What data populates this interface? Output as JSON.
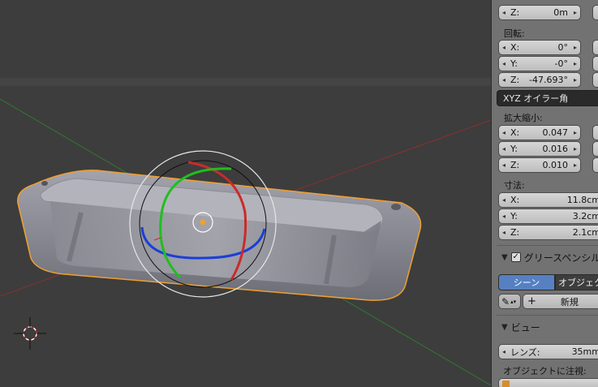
{
  "location": {
    "z": {
      "label": "Z:",
      "value": "0m"
    }
  },
  "rotation": {
    "header": "回転:",
    "x": {
      "label": "X:",
      "value": "0°"
    },
    "y": {
      "label": "Y:",
      "value": "-0°"
    },
    "z": {
      "label": "Z:",
      "value": "-47.693°"
    },
    "mode": "XYZ オイラー角"
  },
  "scale": {
    "header": "拡大縮小:",
    "x": {
      "label": "X:",
      "value": "0.047"
    },
    "y": {
      "label": "Y:",
      "value": "0.016"
    },
    "z": {
      "label": "Z:",
      "value": "0.010"
    }
  },
  "dimensions": {
    "header": "寸法:",
    "x": {
      "label": "X:",
      "value": "11.8cm"
    },
    "y": {
      "label": "Y:",
      "value": "3.2cm"
    },
    "z": {
      "label": "Z:",
      "value": "2.1cm"
    }
  },
  "grease_pencil": {
    "header": "グリースペンシル",
    "tab_scene": "シーン",
    "tab_object": "オブジェクト",
    "new_button": "新規"
  },
  "view": {
    "header": "ビュー",
    "lens": {
      "label": "レンズ:",
      "value": "35mm"
    },
    "lock_label": "オブジェクトに注視:"
  },
  "colors": {
    "axis_x": "#cc2a2a",
    "axis_y": "#1fbf1f",
    "axis_z": "#1a3fd6",
    "selection_outline": "#f0a030",
    "active_tab": "#5680c2"
  },
  "icons": {
    "arrow_left": "◂",
    "arrow_right": "▸",
    "triangle_down": "▼",
    "check": "✓",
    "pencil": "✎",
    "plus": "+"
  }
}
